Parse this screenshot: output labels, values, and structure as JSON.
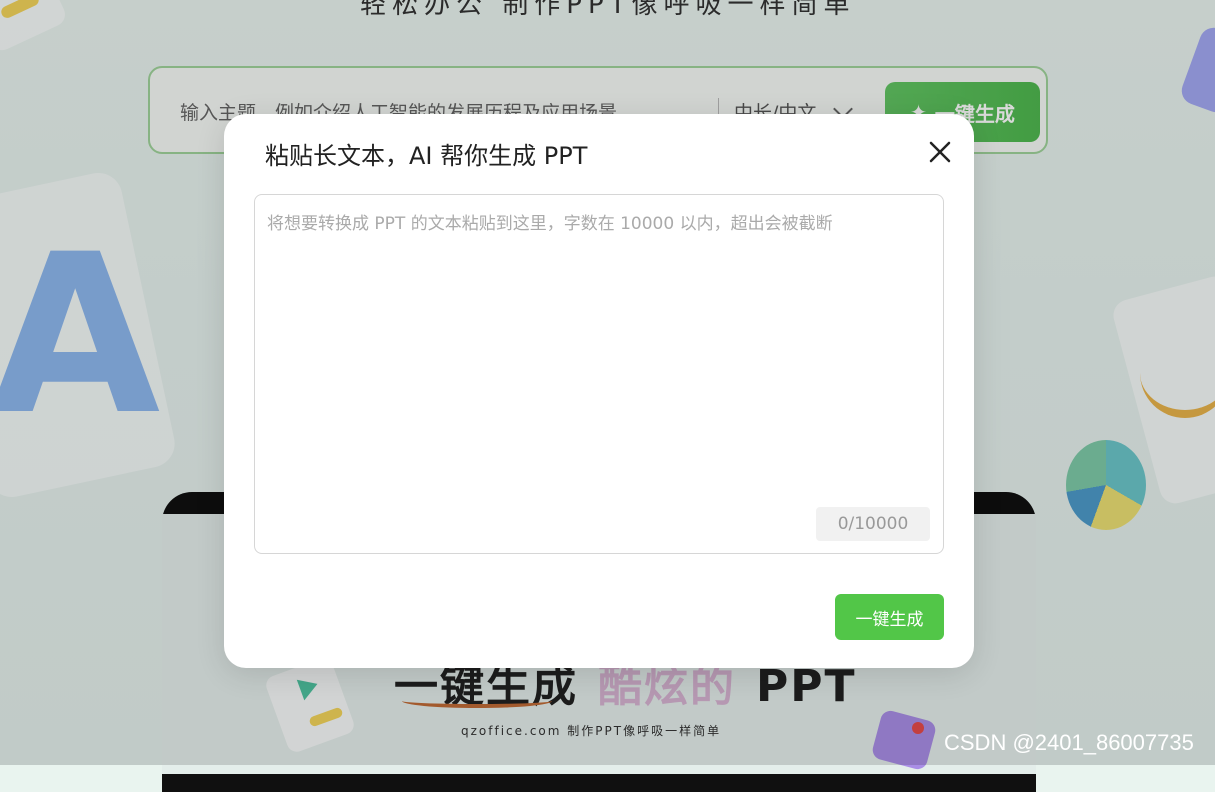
{
  "background": {
    "tagline": "轻松办公 制作PPT像呼吸一样简单",
    "search": {
      "placeholder": "输入主题，例如介绍人工智能的发展历程及应用场景",
      "lang_select": "中长/中文",
      "generate_label": "一键生成",
      "generate_icon": "sparkle-icon"
    },
    "laptop": {
      "headline_left": "一键生成",
      "headline_mid": "酷炫的",
      "headline_right": "PPT",
      "subline": "qzoffice.com 制作PPT像呼吸一样简单"
    }
  },
  "modal": {
    "title": "粘贴长文本，AI 帮你生成 PPT",
    "close_icon": "close-icon",
    "textarea": {
      "placeholder": "将想要转换成 PPT 的文本粘贴到这里，字数在 10000 以内，超出会被截断",
      "value": ""
    },
    "char_count": "0/10000",
    "submit_label": "一键生成"
  },
  "watermark": "CSDN @2401_86007735",
  "colors": {
    "accent_green": "#52c648",
    "overlay": "rgba(0,0,0,0.15)"
  }
}
